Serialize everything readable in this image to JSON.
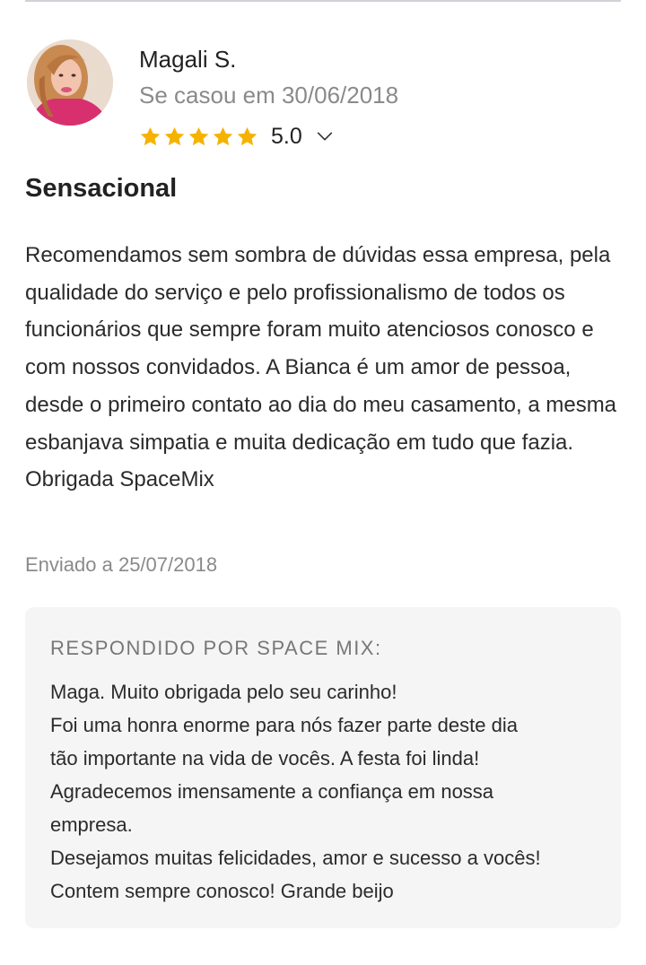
{
  "reviewer": {
    "name": "Magali S.",
    "wedding_date": "Se casou em 30/06/2018",
    "rating_value": "5.0",
    "rating_stars": 5
  },
  "review": {
    "title": "Sensacional",
    "body": "Recomendamos sem sombra de dúvidas essa empresa, pela qualidade do serviço e pelo profissionalismo de todos os funcionários que sempre foram muito atenciosos conosco e com nossos convidados. A Bianca é um amor de pessoa, desde o primeiro contato ao dia do meu casamento, a mesma esbanjava simpatia e muita dedicação em tudo que fazia. Obrigada SpaceMix",
    "sent_date": "Enviado a 25/07/2018"
  },
  "response": {
    "header": "RESPONDIDO POR SPACE MIX:",
    "lines": [
      "Maga. Muito obrigada pelo seu carinho!",
      "Foi uma honra enorme para nós fazer parte deste dia",
      "tão importante na vida de vocês. A festa foi linda!",
      "Agradecemos imensamente a confiança em nossa",
      "empresa.",
      "Desejamos muitas felicidades, amor e sucesso a vocês!",
      "Contem sempre conosco! Grande beijo"
    ]
  },
  "colors": {
    "star": "#f5b301",
    "muted_text": "#8a8a8a",
    "response_bg": "#f5f5f5"
  },
  "icons": {
    "star": "star-icon",
    "expand": "chevron-down-icon"
  }
}
